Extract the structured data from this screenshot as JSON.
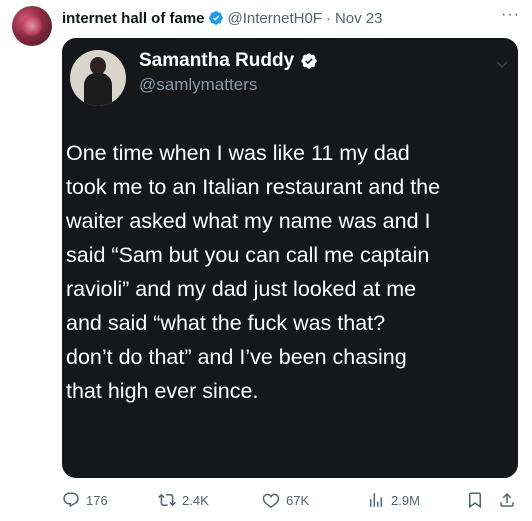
{
  "tweet": {
    "author_name": "internet hall of fame",
    "author_handle": "@InternetH0F",
    "separator": "·",
    "date": "Nov 23",
    "more_label": "···"
  },
  "media": {
    "inner_name": "Samantha Ruddy",
    "inner_handle": "@samlymatters",
    "text": "One time when I was like 11 my dad\ntook me to an Italian restaurant and the\nwaiter asked what my name was and I\nsaid “Sam but you can call me captain\nravioli” and my dad just looked at me\nand said “what the fuck was that?\ndon’t do that” and I’ve been chasing\nthat high ever since."
  },
  "actions": {
    "replies": "176",
    "reposts": "2.4K",
    "likes": "67K",
    "views": "2.9M"
  },
  "colors": {
    "verified": "#1d9bf0",
    "muted": "#536471",
    "media_bg": "#15171b"
  },
  "icons": [
    "verified-badge-icon",
    "more-icon",
    "chevron-down-icon",
    "reply-icon",
    "repost-icon",
    "like-icon",
    "views-icon",
    "bookmark-icon",
    "share-icon"
  ]
}
